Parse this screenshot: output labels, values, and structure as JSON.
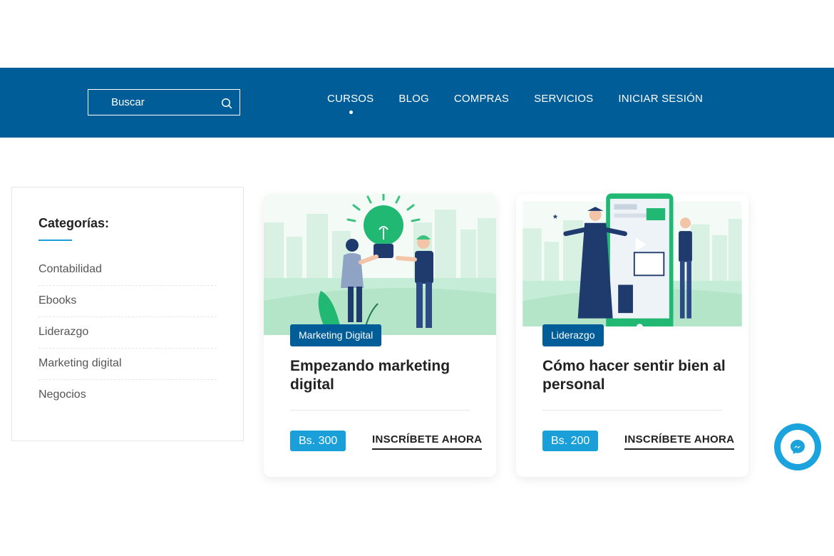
{
  "header": {
    "search": {
      "placeholder": "Buscar",
      "icon": "search-icon"
    },
    "nav": [
      {
        "label": "CURSOS",
        "active": true
      },
      {
        "label": "BLOG",
        "active": false
      },
      {
        "label": "COMPRAS",
        "active": false
      },
      {
        "label": "SERVICIOS",
        "active": false
      },
      {
        "label": "INICIAR SESIÓN",
        "active": false
      }
    ]
  },
  "sidebar": {
    "title": "Categorías:",
    "categories": [
      "Contabilidad",
      "Ebooks",
      "Liderazgo",
      "Marketing digital",
      "Negocios"
    ]
  },
  "courses": [
    {
      "tag": "Marketing Digital",
      "title": "Empezando marketing digital",
      "price": "Bs. 300",
      "cta": "INSCRÍBETE AHORA"
    },
    {
      "tag": "Liderazgo",
      "title": "Cómo hacer sentir bien al personal",
      "price": "Bs. 200",
      "cta": "INSCRÍBETE AHORA"
    }
  ],
  "colors": {
    "brand": "#005d97",
    "accent": "#1a9fd9",
    "illustration_green": "#20b872"
  },
  "chat": {
    "icon": "messenger-icon"
  }
}
